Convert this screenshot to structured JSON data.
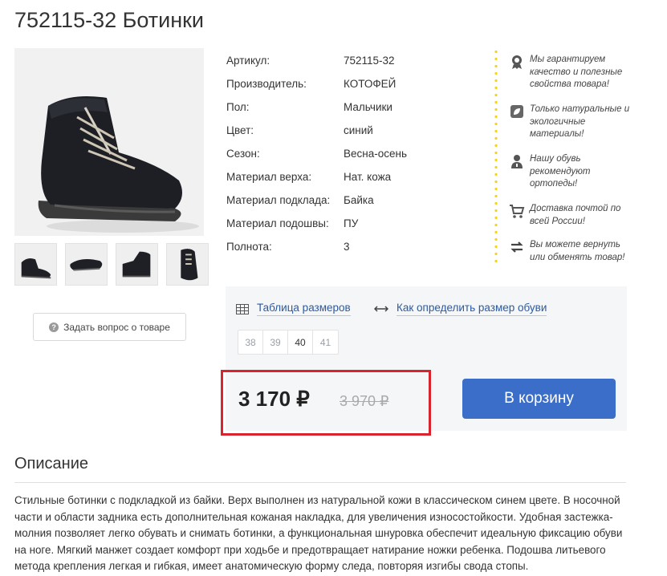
{
  "product": {
    "title": "752115-32 Ботинки"
  },
  "gallery": {
    "thumb_count": 4
  },
  "ask_button": {
    "label": "Задать вопрос о товаре",
    "icon": "question-icon"
  },
  "properties": [
    {
      "label": "Артикул:",
      "value": "752115-32"
    },
    {
      "label": "Производитель:",
      "value": "КОТОФЕЙ"
    },
    {
      "label": "Пол:",
      "value": "Мальчики"
    },
    {
      "label": "Цвет:",
      "value": "синий"
    },
    {
      "label": "Сезон:",
      "value": "Весна-осень"
    },
    {
      "label": "Материал верха:",
      "value": "Нат. кожа"
    },
    {
      "label": "Материал подклада:",
      "value": "Байка"
    },
    {
      "label": "Материал подошвы:",
      "value": "ПУ"
    },
    {
      "label": "Полнота:",
      "value": "3"
    }
  ],
  "guarantees": [
    {
      "icon": "ribbon-icon",
      "text": "Мы гарантируем качество и полезные свойства товара!"
    },
    {
      "icon": "leaf-icon",
      "text": "Только натуральные и экологичные материалы!"
    },
    {
      "icon": "doctor-icon",
      "text": "Нашу обувь рекомендуют ортопеды!"
    },
    {
      "icon": "cart-icon",
      "text": "Доставка почтой по всей России!"
    },
    {
      "icon": "exchange-icon",
      "text": "Вы можете вернуть или обменять товар!"
    }
  ],
  "size_links": {
    "table": "Таблица размеров",
    "howto": "Как определить размер обуви"
  },
  "sizes": {
    "options": [
      "38",
      "39",
      "40",
      "41"
    ],
    "selected": "40"
  },
  "price": {
    "current": "3 170 ₽",
    "old": "3 970 ₽"
  },
  "cart_button": {
    "label": "В корзину"
  },
  "description": {
    "title": "Описание",
    "text": "Стильные ботинки с подкладкой из байки. Верх выполнен из натуральной кожи в классическом синем цвете. В носочной части и области задника есть дополнительная кожаная накладка, для увеличения износостойкости. Удобная застежка-молния позволяет легко обувать и снимать ботинки, а функциональная шнуровка обеспечит идеальную фиксацию обуви на ноге. Мягкий манжет создает комфорт при ходьбе и предотвращает натирание ножки ребенка. Подошва литьевого метода крепления легкая и гибкая, имеет анатомическую форму следа, повторяя изгибы свода стопы."
  },
  "colors": {
    "accent_blue": "#3a6ec9",
    "link_blue": "#2c5aa0",
    "highlight_red": "#d9232e",
    "dots_yellow": "#f5d316"
  }
}
